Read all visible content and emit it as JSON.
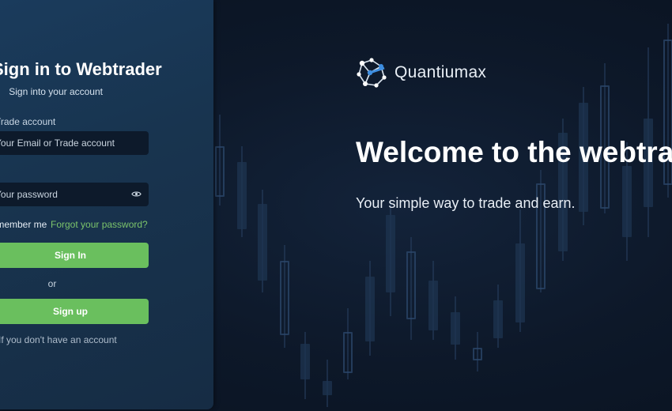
{
  "login": {
    "title": "Sign in to Webtrader",
    "subtitle": "Sign into your account",
    "account_label": "Trade account",
    "account_placeholder": "Your Email or Trade account",
    "password_placeholder": "Your password",
    "remember_label": "Remember me",
    "forgot_link": "Forgot your password?",
    "signin_button": "Sign In",
    "or_text": "or",
    "signup_button": "Sign up",
    "no_account_text": "If you don't have an account"
  },
  "hero": {
    "brand_name": "Quantiumax",
    "welcome": "Welcome to the webtrader",
    "tagline": "Your simple way to trade and earn."
  },
  "colors": {
    "accent_green": "#6abf5e",
    "link_green": "#7cc46b",
    "panel_blue": "#1a3b5c",
    "background_navy": "#0e1a2c"
  },
  "icons": [
    "eye-icon",
    "brand-logo-icon"
  ]
}
